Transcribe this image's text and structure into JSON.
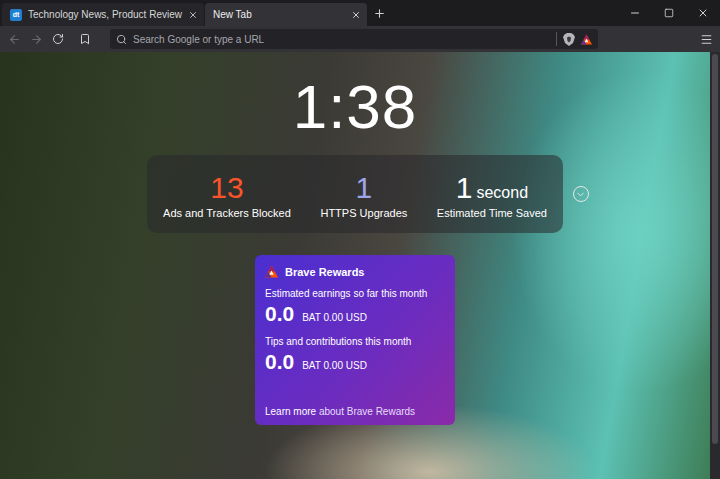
{
  "window": {
    "title": "New Tab"
  },
  "tabs": [
    {
      "label": "Technology News, Product Review",
      "favicon": "dt",
      "selected": false
    },
    {
      "label": "New Tab",
      "selected": true
    }
  ],
  "toolbar": {
    "back_enabled": false,
    "forward_enabled": false,
    "address_placeholder": "Search Google or type a URL"
  },
  "clock": "1:38",
  "stats": [
    {
      "value": "13",
      "label": "Ads and Trackers Blocked",
      "color": "#fb542b"
    },
    {
      "value": "1",
      "label": "HTTPS Upgrades",
      "color": "#a0a5eb"
    },
    {
      "value": "1",
      "unit": "second",
      "label": "Estimated Time Saved",
      "color": "#ffffff"
    }
  ],
  "rewards": {
    "title": "Brave Rewards",
    "sections": [
      {
        "label": "Estimated earnings so far this month",
        "amount": "0.0",
        "currency": "BAT 0.00 USD"
      },
      {
        "label": "Tips and contributions this month",
        "amount": "0.0",
        "currency": "BAT 0.00 USD"
      }
    ],
    "link": "Learn more",
    "link_suffix": "about Brave Rewards"
  }
}
